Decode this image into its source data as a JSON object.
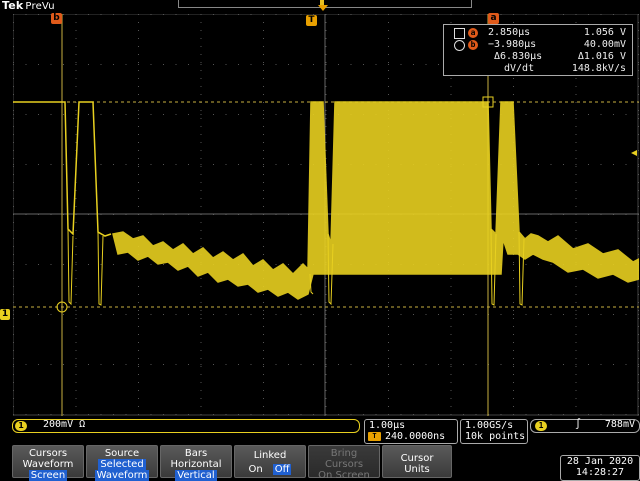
{
  "brand": {
    "name": "Tek",
    "mode": "PreVu"
  },
  "markers": {
    "cursor_b": "b",
    "cursor_a": "a",
    "trigger": "T",
    "ch1": "1"
  },
  "readout": {
    "a_label": "a",
    "b_label": "b",
    "row1_time": "2.850µs",
    "row1_volt": "1.056 V",
    "row2_time": "−3.980µs",
    "row2_volt": "40.00mV",
    "delta_time": "Δ6.830µs",
    "delta_volt": "Δ1.016 V",
    "dvdt_label": "dV/dt",
    "dvdt_value": "148.8kV/s"
  },
  "status": {
    "ch1_badge": "1",
    "ch1_scale": "200mV Ω",
    "timebase": "1.00µs",
    "trigger_delay": "240.0000ns",
    "trigger_icon": "T",
    "sample_rate": "1.00GS/s",
    "record_length": "10k points",
    "trig_ch": "1",
    "trig_slope": "∫",
    "trig_level": "788mV"
  },
  "buttons": [
    {
      "line1": "Cursors",
      "line2": "Waveform",
      "line3": "Screen",
      "hl": "line3"
    },
    {
      "line1": "Source",
      "line2": "Selected",
      "line3": "Waveform",
      "hl": "line2"
    },
    {
      "line1": "Bars",
      "line2": "Horizontal",
      "line3": "Vertical",
      "hl": "line3"
    },
    {
      "line1": "Linked",
      "on": "On",
      "off": "Off"
    },
    {
      "line1": "Bring",
      "line2": "Cursors",
      "line3": "On Screen"
    },
    {
      "line1": "Cursor",
      "line2": "Units",
      "line3": ""
    }
  ],
  "datetime": {
    "date": "28 Jan 2020",
    "time": "14:28:27"
  },
  "colors": {
    "ch1": "#e8d020",
    "cursor": "#e05a1a",
    "trigger": "#e8a000"
  }
}
